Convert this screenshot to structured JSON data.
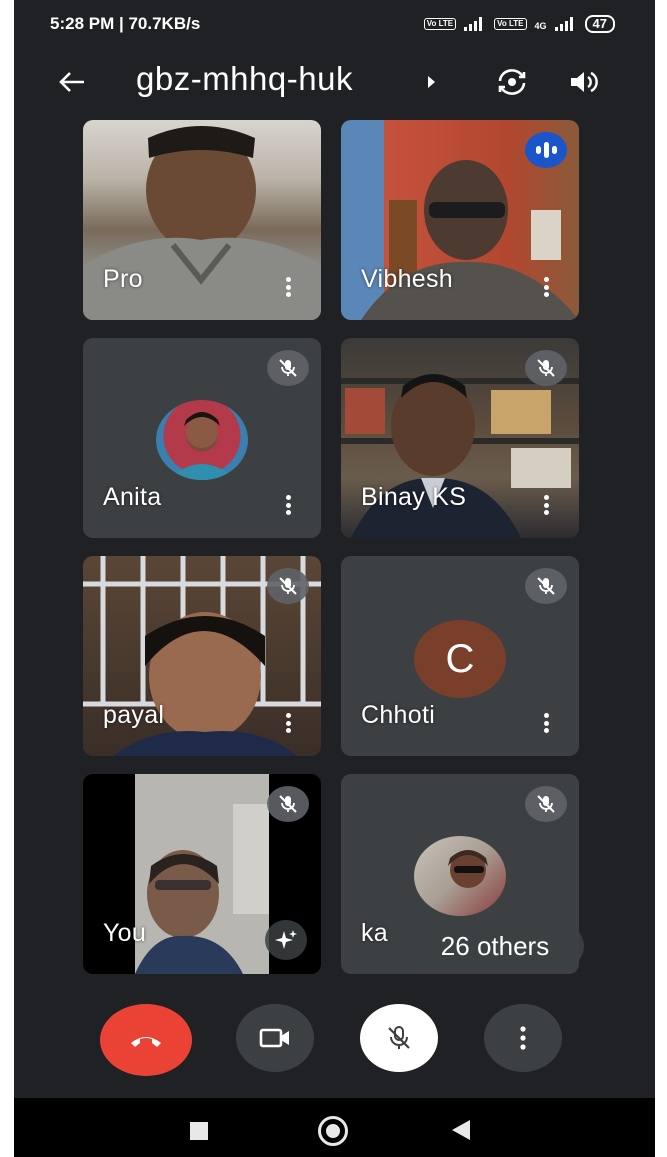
{
  "status_bar": {
    "time_speed": "5:28 PM | 70.7KB/s",
    "volte_1": "Vo LTE",
    "volte_2": "Vo LTE",
    "network": "4G",
    "battery": "47"
  },
  "header": {
    "meeting_code": "gbz-mhhq-huk"
  },
  "tiles": [
    {
      "name": "Pro",
      "state": "video"
    },
    {
      "name": "Vibhesh",
      "state": "video-speaking"
    },
    {
      "name": "Anita",
      "state": "avatar-muted"
    },
    {
      "name": "Binay KS",
      "state": "video-muted"
    },
    {
      "name": "payal",
      "state": "video-muted"
    },
    {
      "name": "Chhoti",
      "state": "letter-muted",
      "initial": "C"
    },
    {
      "name": "You",
      "state": "self-video-muted"
    },
    {
      "name": "ka",
      "state": "avatar-muted"
    }
  ],
  "others_chip": "26 others",
  "colors": {
    "background": "#202124",
    "tile": "#3c4043",
    "end_call": "#ea4335",
    "speaking": "#1a55c9",
    "letter_avatar": "#7a3f2a"
  }
}
